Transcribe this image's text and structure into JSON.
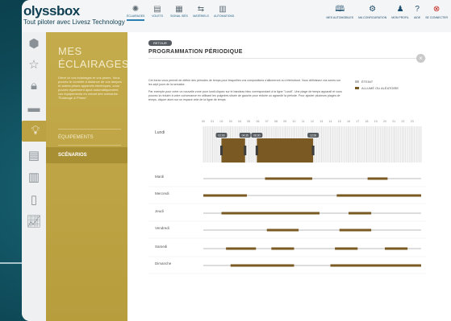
{
  "header": {
    "logo": "olyssbox",
    "tagline": "Tout piloter avec Livesz Technology",
    "nav": [
      {
        "label": "ÉCLAIRAGES",
        "icon": "lightbulb-icon"
      },
      {
        "label": "VOLETS",
        "icon": "shutter-icon"
      },
      {
        "label": "SIGNAL ISÉS",
        "icon": "signal-icon"
      },
      {
        "label": "MATÉRIELS",
        "icon": "devices-icon"
      },
      {
        "label": "AUTOMATIONS",
        "icon": "automation-icon"
      }
    ],
    "right_nav": [
      {
        "label": "MES AUTOMOBILES",
        "icon": "book-icon"
      },
      {
        "label": "MA CONFIGURATION",
        "icon": "config-icon"
      },
      {
        "label": "MON PROFIL",
        "icon": "profile-icon"
      },
      {
        "label": "AIDE",
        "icon": "help-icon"
      },
      {
        "label": "SE CONNECTER",
        "icon": "power-icon"
      }
    ]
  },
  "sidebar_icons": [
    "cube-icon",
    "star-icon",
    "lock-icon",
    "camera-icon",
    "lightbulb-icon",
    "blinds-icon",
    "shutter-icon",
    "battery-icon",
    "graph-icon"
  ],
  "panel": {
    "title_line1": "MES",
    "title_line2": "ÉCLAIRAGES",
    "description": "Gérer ici vos éclairages et vos prises. Vous pouvez le contrôle à distance de vos lampes et autres prises appareils électriques, vous pouvez également ajout automatiquement vos équipements en créant des scénarios \"Éclairage & Prises\".",
    "nav_items": [
      {
        "label": "ÉQUIPEMENTS"
      },
      {
        "label": "SCÉNARIOS"
      }
    ]
  },
  "main": {
    "tag": "RETOUR",
    "title": "PROGRAMMATION PÉRIODIQUE",
    "close": "×",
    "intro_p1": "Cet écran vous permet de définir des périodes de temps pour lesquelles vos compositions s'allumeront ou s'éteindront. Vous définissez vos zones sur les sept jours de la semaine.",
    "intro_p2": "Par exemple pour créer un nouvelle zone pour lundi cliquez sur le bandeau bleu correspondant à la ligne \"Lundi\". Une plage de temps apparaît et vous pouvez la réduire à votre convenance en utilisant les poignées située de gauche pour réduire ou agrandir la période. Pour ajouter plusieurs plages de temps, cliquer alors sur un espace vide de la ligne de temps.",
    "legend": [
      {
        "label": "ÉTEINT",
        "color": "#bdbdbd"
      },
      {
        "label": "ALLUMÉ OU ALÉATOIRE",
        "color": "#7a5a22"
      }
    ],
    "hours": [
      "00",
      "01",
      "02",
      "03",
      "04",
      "05",
      "06",
      "07",
      "08",
      "09",
      "10",
      "11",
      "12",
      "13",
      "14",
      "15",
      "16",
      "17",
      "18",
      "19",
      "20",
      "21",
      "22",
      "23"
    ],
    "lundi": {
      "label": "Lundi",
      "blocks": [
        {
          "start": 2.0,
          "end": 4.6,
          "start_label": "02:00",
          "end_label": "04:35"
        },
        {
          "start": 5.9,
          "end": 12.1,
          "start_label": "06:00",
          "end_label": "12:00"
        }
      ]
    },
    "days": [
      {
        "label": "Mardi",
        "blocks": [
          {
            "start": 6.8,
            "end": 12.0
          },
          {
            "start": 18.1,
            "end": 20.3
          }
        ]
      },
      {
        "label": "Mercredi",
        "blocks": [
          {
            "start": 0.0,
            "end": 4.8
          },
          {
            "start": 14.7,
            "end": 24.0
          }
        ]
      },
      {
        "label": "Jeudi",
        "blocks": [
          {
            "start": 2.0,
            "end": 12.8
          },
          {
            "start": 16.0,
            "end": 18.5
          }
        ]
      },
      {
        "label": "Vendredi",
        "blocks": [
          {
            "start": 7.0,
            "end": 10.5
          },
          {
            "start": 15.0,
            "end": 18.5
          }
        ]
      },
      {
        "label": "Samedi",
        "blocks": [
          {
            "start": 2.5,
            "end": 5.8
          },
          {
            "start": 7.5,
            "end": 10.0
          },
          {
            "start": 14.5,
            "end": 17.0
          },
          {
            "start": 20.0,
            "end": 22.5
          }
        ]
      },
      {
        "label": "Dimanche",
        "blocks": [
          {
            "start": 3.0,
            "end": 10.0
          },
          {
            "start": 14.0,
            "end": 24.0
          }
        ]
      }
    ],
    "colors": {
      "track": "#dddddd",
      "block": "#7a5a22",
      "lundi_grid": "#f3f3f3",
      "lundi_lines": "#d0d0d0"
    }
  }
}
